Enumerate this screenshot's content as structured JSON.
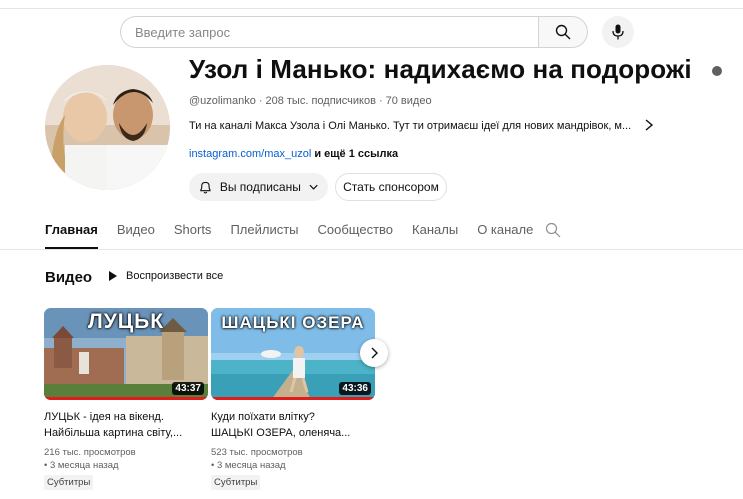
{
  "search": {
    "placeholder": "Введите запрос"
  },
  "channel": {
    "name": "Узол і Манько: надихаємо на подорожі",
    "handle": "@uzolimanko",
    "subscribers": "208 тыс. подписчиков",
    "videos_count": "70 видео",
    "description": "Ти на каналі Макса Узола і Олі Манько. Тут ти отримаєш ідеї для нових мандрівок, м...",
    "link": "instagram.com/max_uzol",
    "more_links": "и ещё 1 ссылка",
    "subscribed_label": "Вы подписаны",
    "sponsor_label": "Стать спонсором"
  },
  "tabs": [
    {
      "label": "Главная",
      "active": true
    },
    {
      "label": "Видео"
    },
    {
      "label": "Shorts"
    },
    {
      "label": "Плейлисты"
    },
    {
      "label": "Сообщество"
    },
    {
      "label": "Каналы"
    },
    {
      "label": "О канале"
    }
  ],
  "section": {
    "title": "Видео",
    "play_all": "Воспроизвести все"
  },
  "videos": [
    {
      "thumb_text": "ЛУЦЬК",
      "duration": "43:37",
      "title_line1": "ЛУЦЬК - ідея на вікенд.",
      "title_line2": "Найбільша картина світу,...",
      "views": "216 тыс. просмотров",
      "age": "• 3 месяца назад",
      "badge": "Субтитры"
    },
    {
      "thumb_text": "ШАЦЬКІ ОЗЕРА",
      "duration": "43:36",
      "title_line1": "Куди поїхати влітку?",
      "title_line2": "ШАЦЬКІ ОЗЕРА, оленяча...",
      "views": "523 тыс. просмотров",
      "age": "• 3 месяца назад",
      "badge": "Субтитры"
    }
  ],
  "colors": {
    "link": "#065fd4",
    "progress": "#e21b1b",
    "muted": "#606060"
  }
}
